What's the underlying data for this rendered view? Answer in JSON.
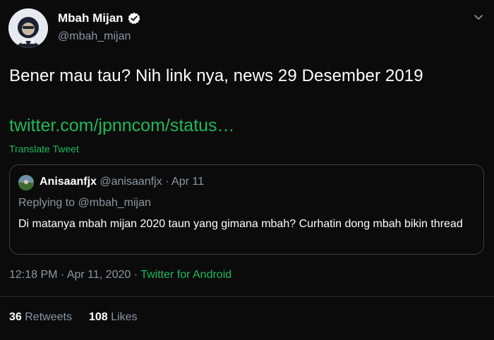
{
  "author": {
    "name": "Mbah Mijan",
    "handle": "@mbah_mijan"
  },
  "tweet": {
    "text": "Bener mau tau? Nih link nya, news 29 Desember 2019",
    "link_text": "twitter.com/jpnncom/status…",
    "translate_label": "Translate Tweet"
  },
  "quote": {
    "name": "Anisaanfjx",
    "handle": "@anisaanfjx",
    "sep": "·",
    "date": "Apr 11",
    "replying_to": "Replying to @mbah_mijan",
    "text": "Di matanya mbah mijan 2020 taun yang gimana mbah?  Curhatin dong mbah bikin thread"
  },
  "meta": {
    "time": "12:18 PM",
    "sep": "·",
    "date": "Apr 11, 2020",
    "source": "Twitter for Android"
  },
  "stats": {
    "retweets_count": "36",
    "retweets_label": "Retweets",
    "likes_count": "108",
    "likes_label": "Likes"
  },
  "colors": {
    "accent": "#1fb85a",
    "background": "#0b0b0b",
    "secondary_text": "#8b98a5"
  },
  "icons": [
    "avatar",
    "verified-badge-icon",
    "chevron-down-icon",
    "quote-avatar"
  ]
}
